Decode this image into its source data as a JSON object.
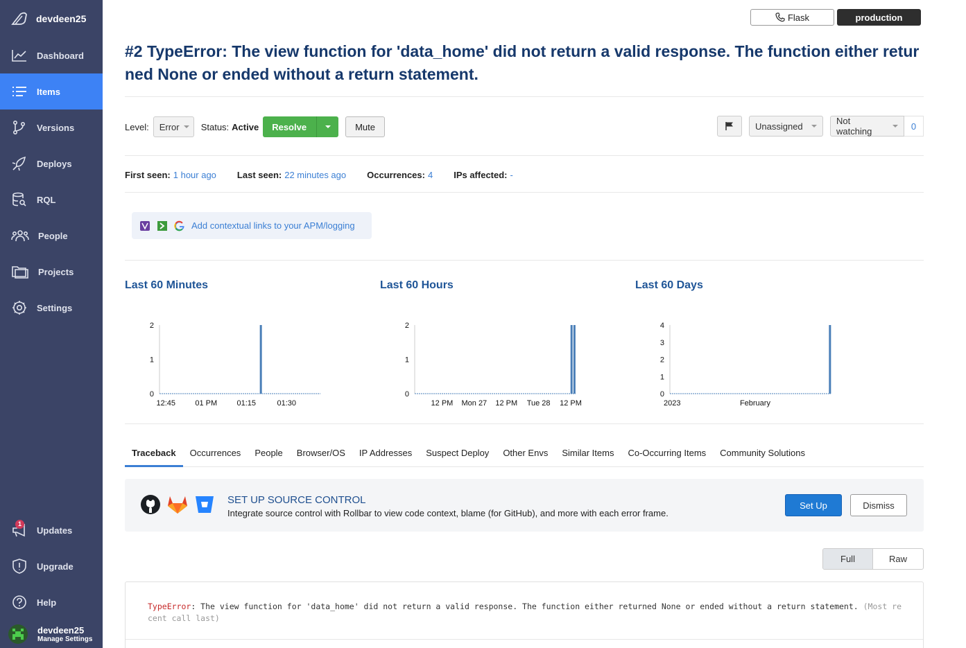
{
  "sidebar": {
    "brand": "devdeen25",
    "items": [
      {
        "label": "Dashboard",
        "icon": "chart-line-icon"
      },
      {
        "label": "Items",
        "icon": "list-icon",
        "active": true
      },
      {
        "label": "Versions",
        "icon": "git-branch-icon"
      },
      {
        "label": "Deploys",
        "icon": "rocket-icon"
      },
      {
        "label": "RQL",
        "icon": "database-search-icon"
      },
      {
        "label": "People",
        "icon": "people-icon"
      },
      {
        "label": "Projects",
        "icon": "folder-icon"
      },
      {
        "label": "Settings",
        "icon": "gear-icon"
      }
    ],
    "bottom": {
      "updates": "Updates",
      "updates_badge": "1",
      "upgrade": "Upgrade",
      "help": "Help",
      "user_name": "devdeen25",
      "user_sub": "Manage Settings"
    }
  },
  "topbar": {
    "framework": "Flask",
    "environment": "production"
  },
  "item": {
    "title": "#2 TypeError: The view function for 'data_home' did not return a valid response. The function either returned None or ended without a return statement."
  },
  "controls": {
    "level_label": "Level:",
    "level_value": "Error",
    "status_label": "Status:",
    "status_value": "Active",
    "resolve": "Resolve",
    "mute": "Mute",
    "assignee": "Unassigned",
    "watching": "Not watching",
    "watch_count": "0"
  },
  "stats": {
    "first_seen_label": "First seen:",
    "first_seen": "1 hour ago",
    "last_seen_label": "Last seen:",
    "last_seen": "22 minutes ago",
    "occurrences_label": "Occurrences:",
    "occurrences": "4",
    "ips_label": "IPs affected:",
    "ips": "-"
  },
  "context_links": "Add contextual links to your APM/logging",
  "charts": {
    "minutes_title": "Last 60 Minutes",
    "hours_title": "Last 60 Hours",
    "days_title": "Last 60 Days"
  },
  "chart_data": [
    {
      "type": "bar",
      "title": "Last 60 Minutes",
      "x_ticks": [
        "12:45",
        "01 PM",
        "01:15",
        "01:30"
      ],
      "y_ticks": [
        "0",
        "1",
        "2"
      ],
      "ylim": [
        0,
        2
      ],
      "bars": [
        {
          "at": "~01:20",
          "value": 2
        }
      ]
    },
    {
      "type": "bar",
      "title": "Last 60 Hours",
      "x_ticks": [
        "12 PM",
        "Mon 27",
        "12 PM",
        "Tue 28",
        "12 PM"
      ],
      "y_ticks": [
        "0",
        "1",
        "2"
      ],
      "ylim": [
        0,
        2
      ],
      "bars": [
        {
          "at": "Tue 28 ~12 PM",
          "value": 2
        },
        {
          "at": "Tue 28 ~1 PM",
          "value": 2
        }
      ]
    },
    {
      "type": "bar",
      "title": "Last 60 Days",
      "x_ticks": [
        "2023",
        "February"
      ],
      "y_ticks": [
        "0",
        "1",
        "2",
        "3",
        "4"
      ],
      "ylim": [
        0,
        4
      ],
      "bars": [
        {
          "at": "late February",
          "value": 4
        }
      ]
    }
  ],
  "tabs": [
    "Traceback",
    "Occurrences",
    "People",
    "Browser/OS",
    "IP Addresses",
    "Suspect Deploy",
    "Other Envs",
    "Similar Items",
    "Co-Occurring Items",
    "Community Solutions"
  ],
  "source_control": {
    "heading": "SET UP SOURCE CONTROL",
    "description": "Integrate source control with Rollbar to view code context, blame (for GitHub), and more with each error frame.",
    "setup": "Set Up",
    "dismiss": "Dismiss"
  },
  "view_toggle": {
    "full": "Full",
    "raw": "Raw"
  },
  "traceback": {
    "error_type": "TypeError",
    "message": ": The view function for 'data_home' did not return a valid response. The function either returned None or ended without a return statement. ",
    "suffix": "(Most recent call last)"
  },
  "colors": {
    "sidebar_bg": "#3b4466",
    "accent": "#3d82f5",
    "resolve": "#4cb14c",
    "chart_bar": "#4a7fb8"
  }
}
